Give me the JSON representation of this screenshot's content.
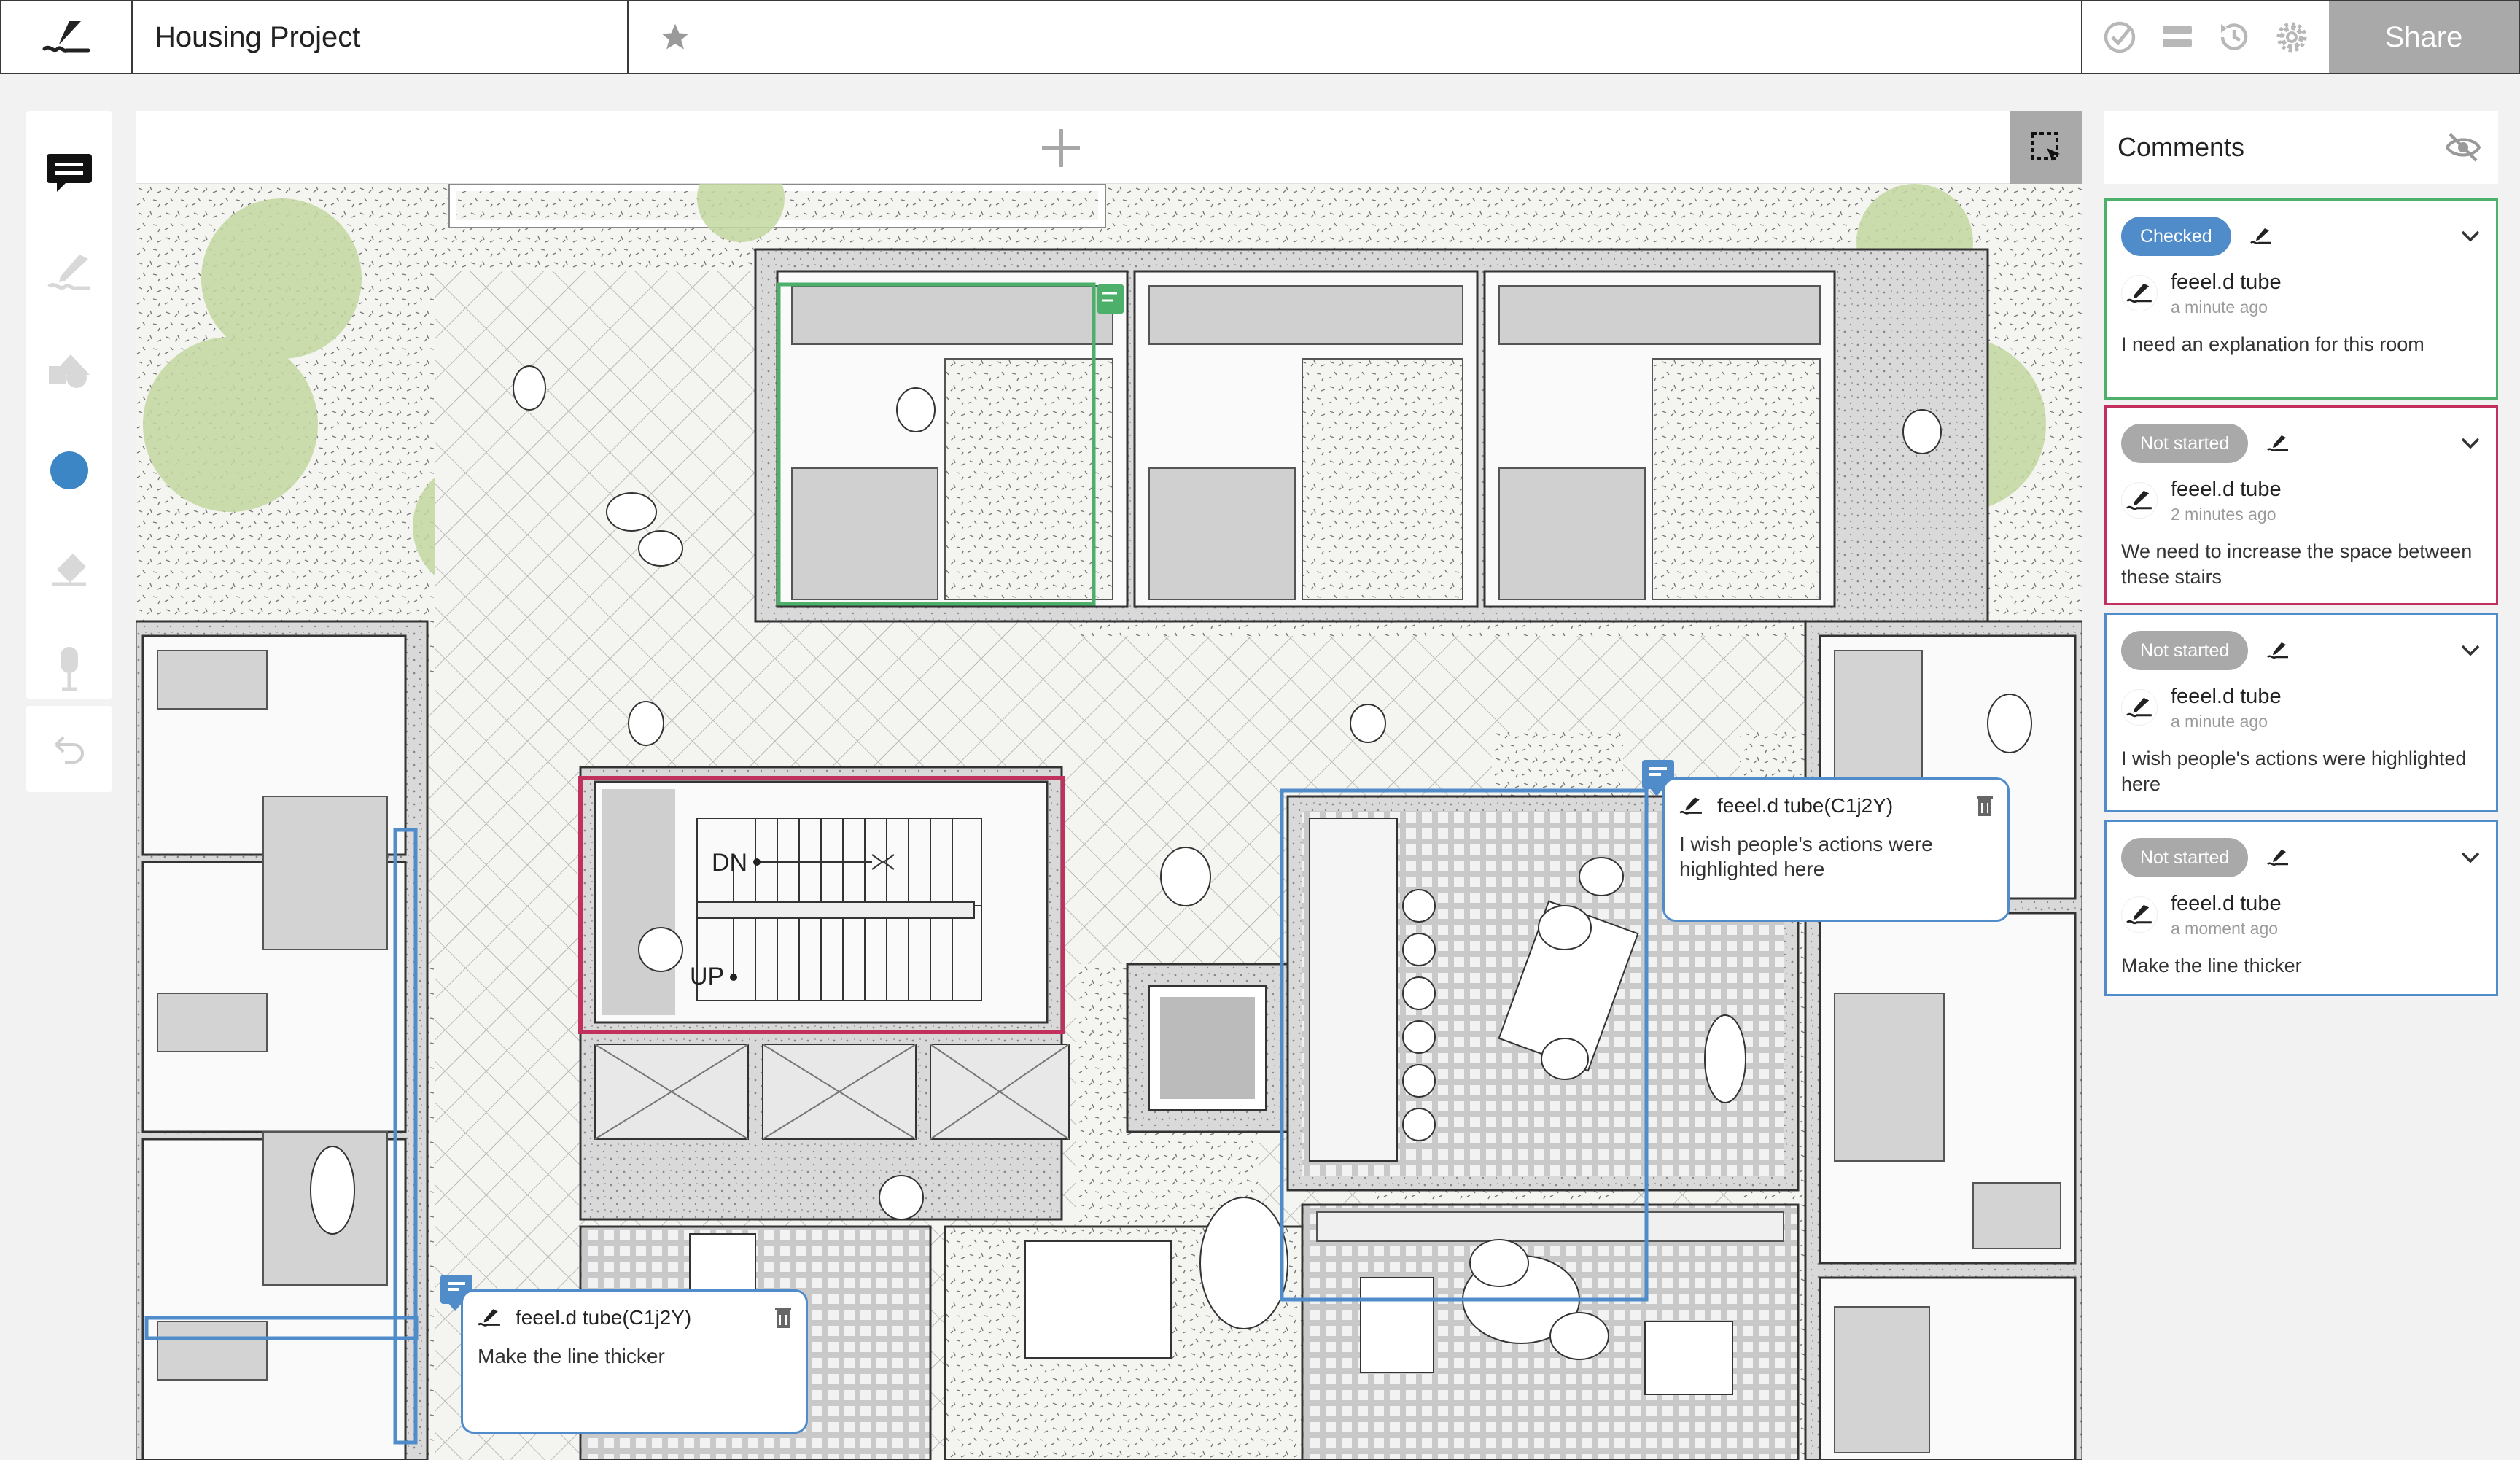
{
  "app": {
    "project_title": "Housing Project",
    "share_label": "Share"
  },
  "toolbar_icons": [
    "logo-signature-icon",
    "star-icon",
    "check-circle-icon",
    "layers-icon",
    "history-icon",
    "gear-icon"
  ],
  "palette": {
    "tools": [
      "comment-icon",
      "pen-icon",
      "shapes-icon",
      "color-swatch",
      "eraser-icon",
      "microphone-icon"
    ],
    "active_tool": "comment-icon",
    "active_color": "#3d86c6",
    "undo": "undo-icon"
  },
  "canvas": {
    "add_icon": "plus-icon",
    "select_icon": "marquee-select-icon",
    "annotations": [
      {
        "color": "#4caf6a",
        "status": "Checked"
      },
      {
        "color": "#c2305e",
        "status": "Not started"
      },
      {
        "color": "#4f8cc9",
        "status": "Not started"
      },
      {
        "color": "#4f8cc9",
        "status": "Not started"
      }
    ],
    "plan_labels": {
      "dn": "DN",
      "up": "UP"
    },
    "popups": [
      {
        "author": "feeel.d tube(C1j2Y)",
        "text": "I wish people's actions were highlighted here"
      },
      {
        "author": "feeel.d tube(C1j2Y)",
        "text": "Make the line thicker"
      }
    ]
  },
  "comments": {
    "title": "Comments",
    "hide_icon": "eye-off-icon",
    "items": [
      {
        "status": "Checked",
        "status_color": "#4f8cc9",
        "border": "#4caf6a",
        "author": "feeel.d tube",
        "time": "a minute ago",
        "text": "I need an explanation for this room"
      },
      {
        "status": "Not started",
        "status_color": "#a9a9a9",
        "border": "#c2305e",
        "author": "feeel.d tube",
        "time": "2 minutes ago",
        "text": "We need to increase the space between these stairs"
      },
      {
        "status": "Not started",
        "status_color": "#a9a9a9",
        "border": "#4f8cc9",
        "author": "feeel.d tube",
        "time": "a minute ago",
        "text": "I wish people's actions were highlighted here"
      },
      {
        "status": "Not started",
        "status_color": "#a9a9a9",
        "border": "#4f8cc9",
        "author": "feeel.d tube",
        "time": "a moment ago",
        "text": "Make the line thicker"
      }
    ]
  }
}
